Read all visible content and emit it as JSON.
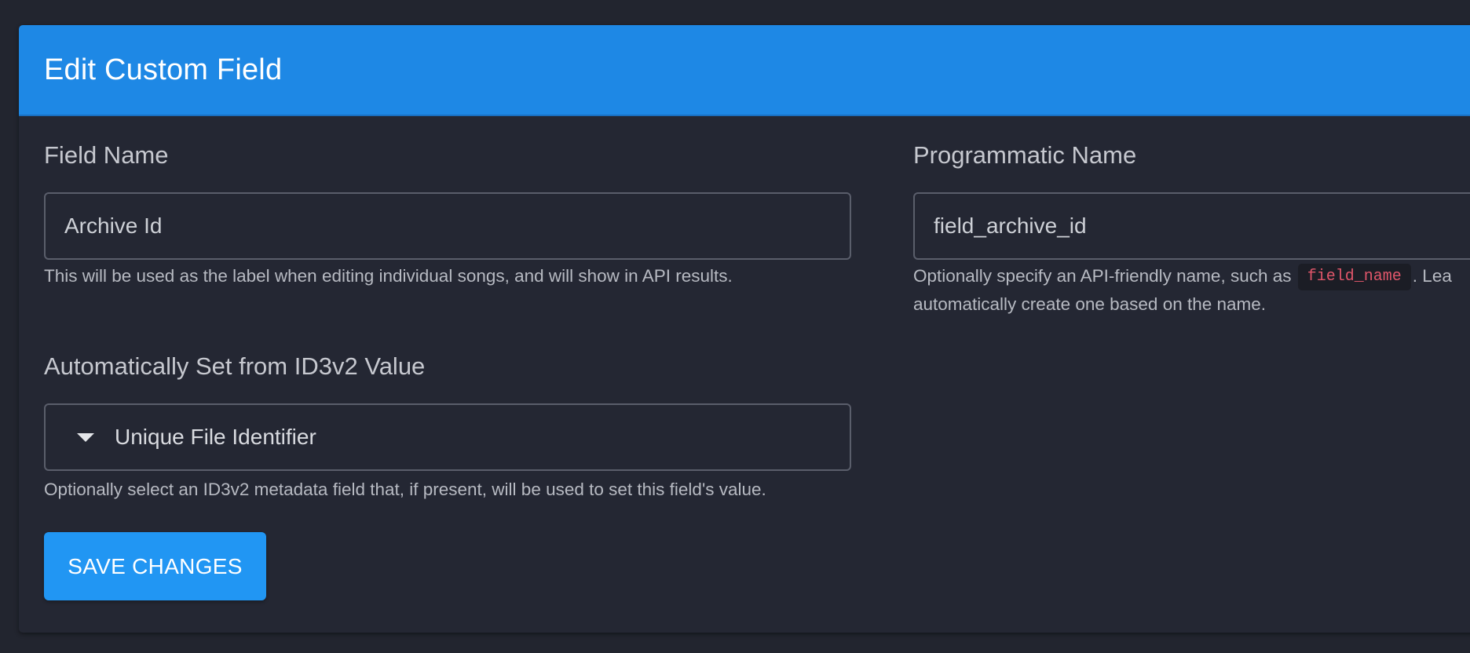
{
  "card": {
    "title": "Edit Custom Field"
  },
  "field_name": {
    "label": "Field Name",
    "value": "Archive Id",
    "help": "This will be used as the label when editing individual songs, and will show in API results."
  },
  "programmatic_name": {
    "label": "Programmatic Name",
    "value": "field_archive_id",
    "help_before_code": "Optionally specify an API-friendly name, such as",
    "help_code": "field_name",
    "help_after_code": ". Lea",
    "help_line2": "automatically create one based on the name."
  },
  "auto_assign": {
    "label": "Automatically Set from ID3v2 Value",
    "selected": "Unique File Identifier",
    "help": "Optionally select an ID3v2 metadata field that, if present, will be used to set this field's value."
  },
  "actions": {
    "save_label": "SAVE CHANGES"
  },
  "colors": {
    "header": "#1e88e5",
    "background": "#22252f",
    "button": "#2196f3",
    "code_text": "#e0566a"
  }
}
